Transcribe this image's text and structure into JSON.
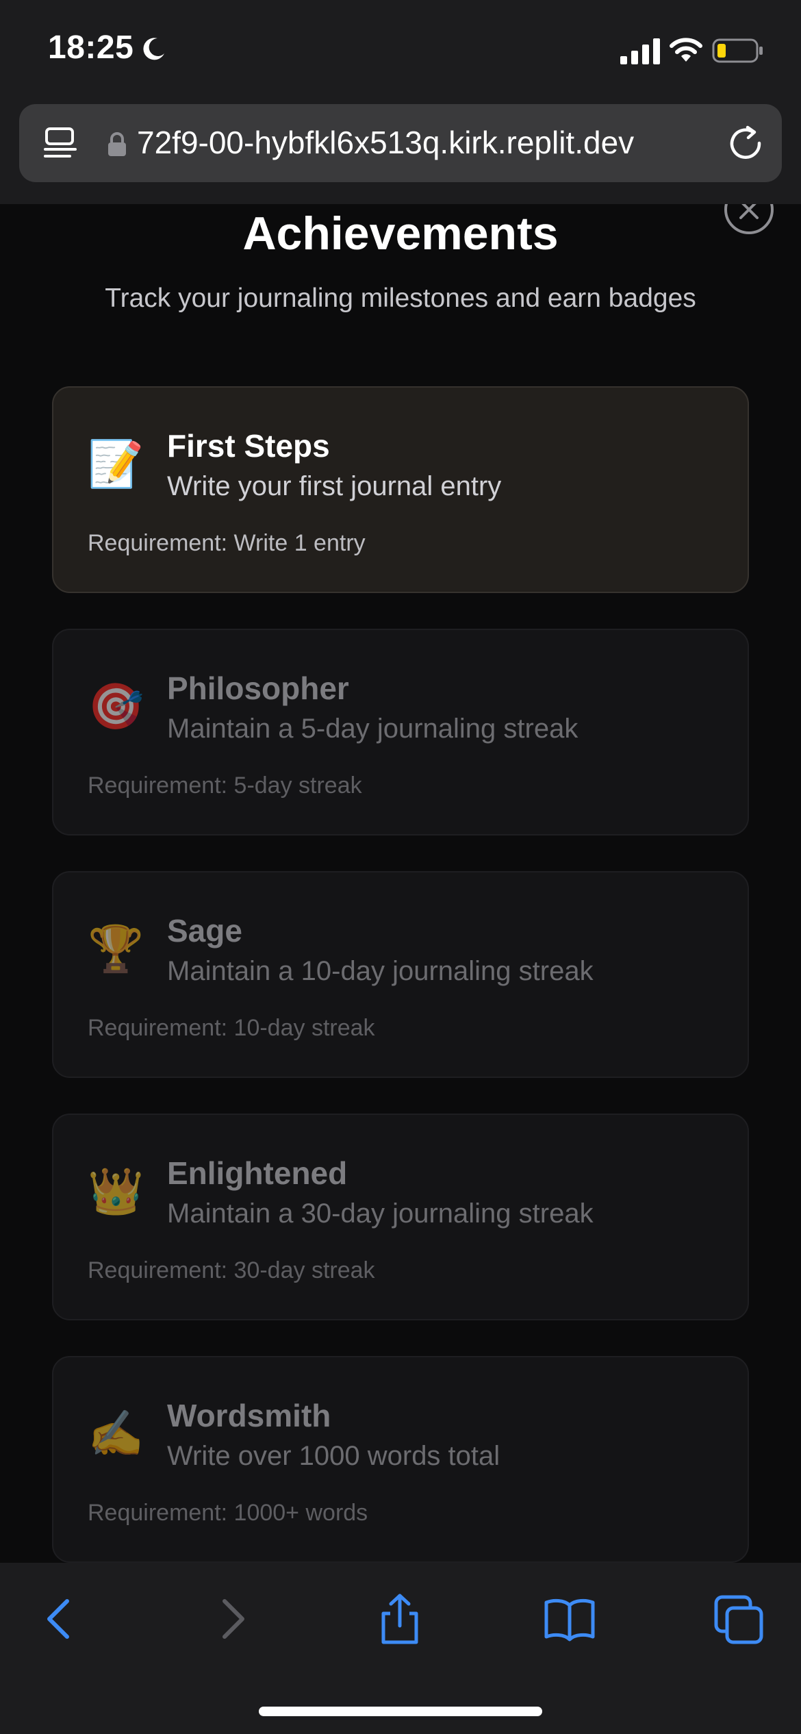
{
  "status_bar": {
    "time": "18:25"
  },
  "browser": {
    "url": "72f9-00-hybfkl6x513q.kirk.replit.dev"
  },
  "page": {
    "title": "Achievements",
    "subtitle": "Track your journaling milestones and earn badges"
  },
  "achievements": [
    {
      "icon": "📝",
      "icon_name": "memo-icon",
      "title": "First Steps",
      "description": "Write your first journal entry",
      "requirement": "Requirement: Write 1 entry",
      "unlocked": true
    },
    {
      "icon": "🎯",
      "icon_name": "target-icon",
      "title": "Philosopher",
      "description": "Maintain a 5-day journaling streak",
      "requirement": "Requirement: 5-day streak",
      "unlocked": false
    },
    {
      "icon": "🏆",
      "icon_name": "trophy-icon",
      "title": "Sage",
      "description": "Maintain a 10-day journaling streak",
      "requirement": "Requirement: 10-day streak",
      "unlocked": false
    },
    {
      "icon": "👑",
      "icon_name": "crown-icon",
      "title": "Enlightened",
      "description": "Maintain a 30-day journaling streak",
      "requirement": "Requirement: 30-day streak",
      "unlocked": false
    },
    {
      "icon": "✍️",
      "icon_name": "writing-hand-icon",
      "title": "Wordsmith",
      "description": "Write over 1000 words total",
      "requirement": "Requirement: 1000+ words",
      "unlocked": false
    }
  ],
  "colors": {
    "accent": "#3d8bf5",
    "background": "#0b0b0c",
    "unlocked_card": "#221f1c",
    "locked_card": "#141416"
  }
}
